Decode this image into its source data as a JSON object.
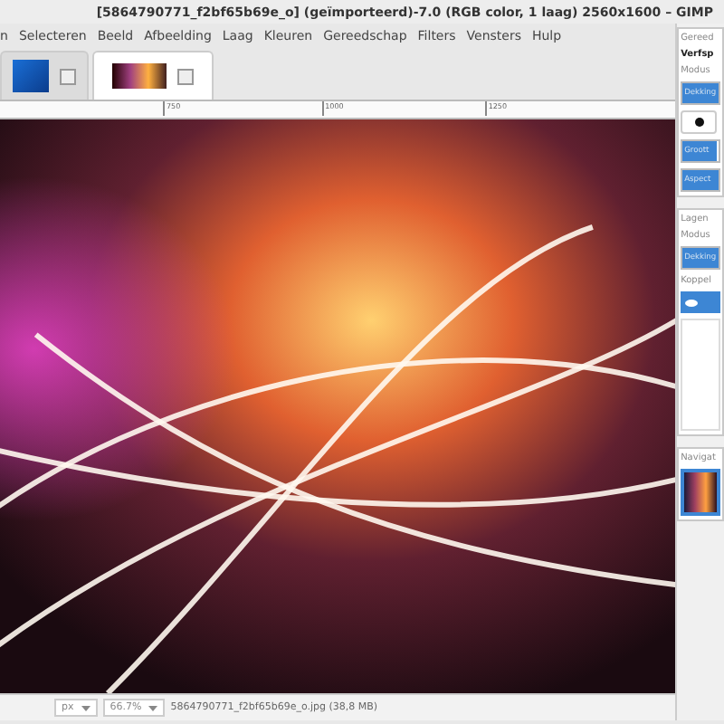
{
  "window": {
    "title": "[5864790771_f2bf65b69e_o] (geïmporteerd)-7.0 (RGB color, 1 laag) 2560x1600 – GIMP"
  },
  "menu": [
    "n",
    "Selecteren",
    "Beeld",
    "Afbeelding",
    "Laag",
    "Kleuren",
    "Gereedschap",
    "Filters",
    "Vensters",
    "Hulp"
  ],
  "image_tabs": [
    {
      "selected": false
    },
    {
      "selected": true
    }
  ],
  "ruler": [
    "750",
    "1000",
    "1250"
  ],
  "status_bar": {
    "unit": "px",
    "zoom": "66.7%",
    "file": "5864790771_f2bf65b69e_o.jpg (38,8 MB)"
  },
  "dock": {
    "tool_options": {
      "title": "Gereed",
      "tool": "Verfsp",
      "labels": [
        "Modus"
      ],
      "rows": [
        {
          "label": "Dekking",
          "level": 1
        },
        {
          "label": "Groott",
          "level": 0.95
        },
        {
          "label": "Aspect",
          "level": 1
        }
      ]
    },
    "layers": {
      "title": "Lagen",
      "labels": [
        "Modus"
      ],
      "rows": [
        {
          "label": "Dekking",
          "level": 1
        }
      ],
      "lock": "Koppel"
    },
    "navigation": {
      "title": "Navigat"
    }
  }
}
